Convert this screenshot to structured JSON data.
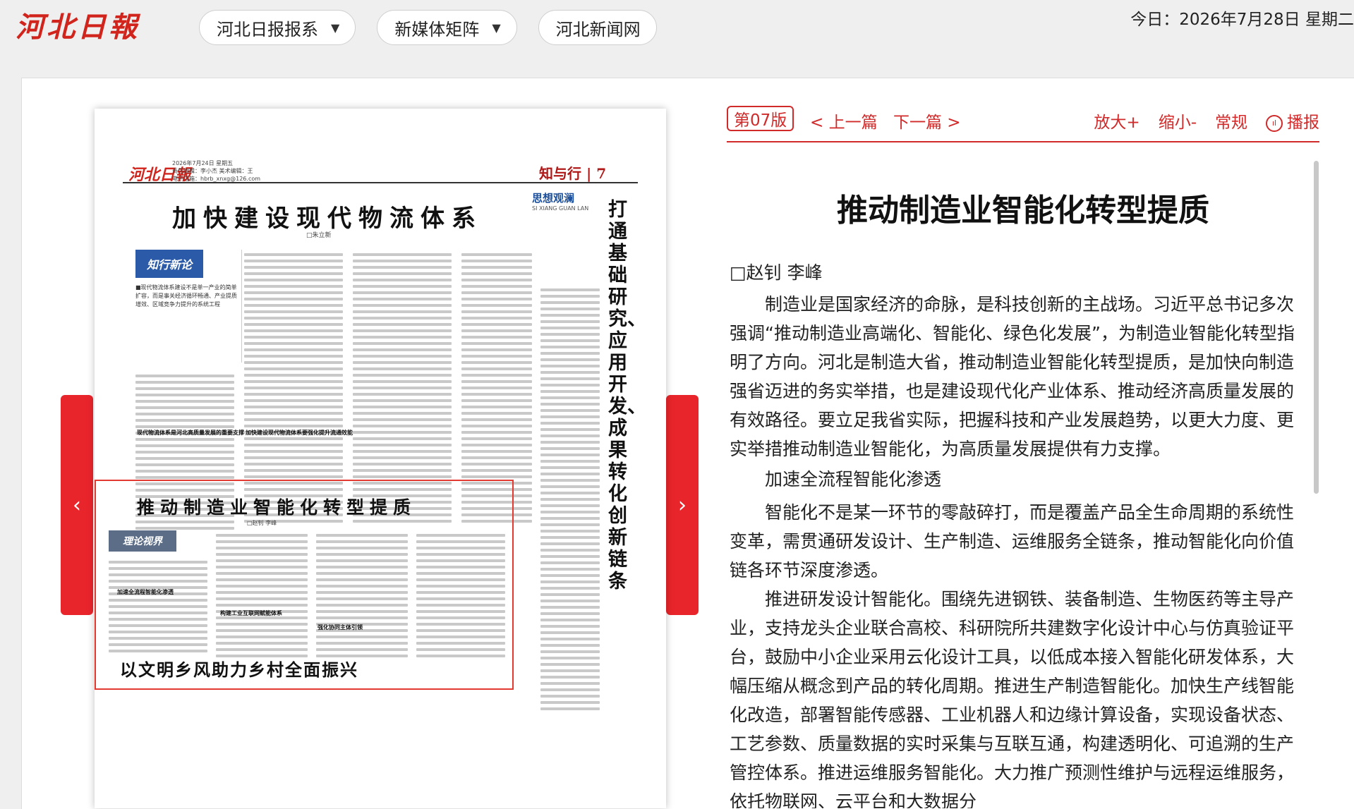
{
  "header": {
    "logo_text": "河北日報",
    "nav": [
      {
        "label": "河北日报报系",
        "has_dropdown": true
      },
      {
        "label": "新媒体矩阵",
        "has_dropdown": true
      },
      {
        "label": "河北新闻网",
        "has_dropdown": false
      }
    ],
    "date_text": "今日：2026年7月28日 星期二"
  },
  "paper": {
    "masthead": "河北日報",
    "meta_line1": "2026年7月24日 星期五",
    "meta_line2": "责任编辑：李小杰  美术编辑：王",
    "meta_line3": "电子信箱：hbrb_xnxg@126.com",
    "section_label": "知与行 | 7",
    "headline_top": "加快建设现代物流体系",
    "byline_top": "□朱立新",
    "column_badge": "思想观澜",
    "column_badge_pinyin": "SI XIANG GUAN LAN",
    "vertical_headline": "打通基础研究、应用开发、成果转化创新链条",
    "side_badge": "知行新论",
    "side_text": "■现代物流体系建设不是单一产业的简单扩容，而是事关经济循环畅通、产业提质增效、区域竞争力提升的系统工程",
    "sub1": "现代物流体系是河北高质量发展的重要支撑",
    "sub2": "加快建设现代物流体系要强化提升流通效能",
    "highlight_headline": "推动制造业智能化转型提质",
    "highlight_byline": "□赵钊 李峰",
    "highlight_badge": "理论视界",
    "hsub1": "加速全流程智能化渗透",
    "hsub2": "构建工业互联网赋能体系",
    "hsub3": "强化协同主体引领",
    "headline_bottom": "以文明乡风助力乡村全面振兴",
    "prev_arrow": "‹",
    "next_arrow": "›"
  },
  "toolbar": {
    "edition": "第07版",
    "prev": "< 上一篇",
    "next": "下一篇 >",
    "zoom_in": "放大+",
    "zoom_out": "缩小-",
    "normal": "常规",
    "play": "播报"
  },
  "article": {
    "title": "推动制造业智能化转型提质",
    "byline": "□赵钊 李峰",
    "p1": "制造业是国家经济的命脉，是科技创新的主战场。习近平总书记多次强调“推动制造业高端化、智能化、绿色化发展”，为制造业智能化转型指明了方向。河北是制造大省，推动制造业智能化转型提质，是加快向制造强省迈进的务实举措，也是建设现代化产业体系、推动经济高质量发展的有效路径。要立足我省实际，把握科技和产业发展趋势，以更大力度、更实举措推动制造业智能化，为高质量发展提供有力支撑。",
    "subhead1": "加速全流程智能化渗透",
    "p2": "智能化不是某一环节的零敲碎打，而是覆盖产品全生命周期的系统性变革，需贯通研发设计、生产制造、运维服务全链条，推动智能化向价值链各环节深度渗透。",
    "p3": "推进研发设计智能化。围绕先进钢铁、装备制造、生物医药等主导产业，支持龙头企业联合高校、科研院所共建数字化设计中心与仿真验证平台，鼓励中小企业采用云化设计工具，以低成本接入智能化研发体系，大幅压缩从概念到产品的转化周期。推进生产制造智能化。加快生产线智能化改造，部署智能传感器、工业机器人和边缘计算设备，实现设备状态、工艺参数、质量数据的实时采集与互联互通，构建透明化、可追溯的生产管控体系。推进运维服务智能化。大力推广预测性维护与远程运维服务，依托物联网、云平台和大数据分"
  },
  "colors": {
    "brand_red": "#d0241c",
    "accent_red": "#d02a2a",
    "arrow_red": "#e8252b"
  }
}
